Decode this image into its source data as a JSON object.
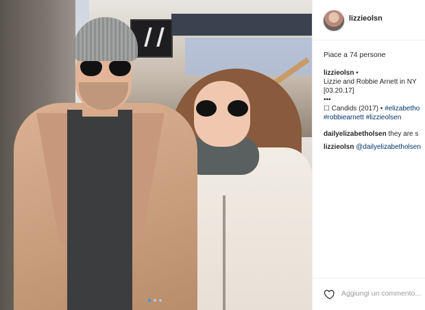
{
  "post": {
    "username": "lizzieolsn",
    "likes": "Piace a 74 persone",
    "caption": {
      "username": "lizzieolsn",
      "bullet": "•",
      "line1": "Lizzie and Robbie Arnett in NY",
      "line2": "[03.20.17]",
      "line3": "•••",
      "line4_prefix": "☐ Candids (2017) •",
      "line4_tag": "#elizabetho",
      "line5_tags": "#robbiearnett #lizzieolsen"
    },
    "comments": [
      {
        "username": "dailyelizabetholsen",
        "text": "they are s"
      },
      {
        "username": "lizzieolsn",
        "text": "@dailyelizabetholsen"
      }
    ],
    "add_comment_placeholder": "Aggiungi un commento..."
  },
  "colors": {
    "accent": "#3897f0",
    "tag": "#003569"
  },
  "icons": [
    "avatar",
    "heart-icon"
  ]
}
